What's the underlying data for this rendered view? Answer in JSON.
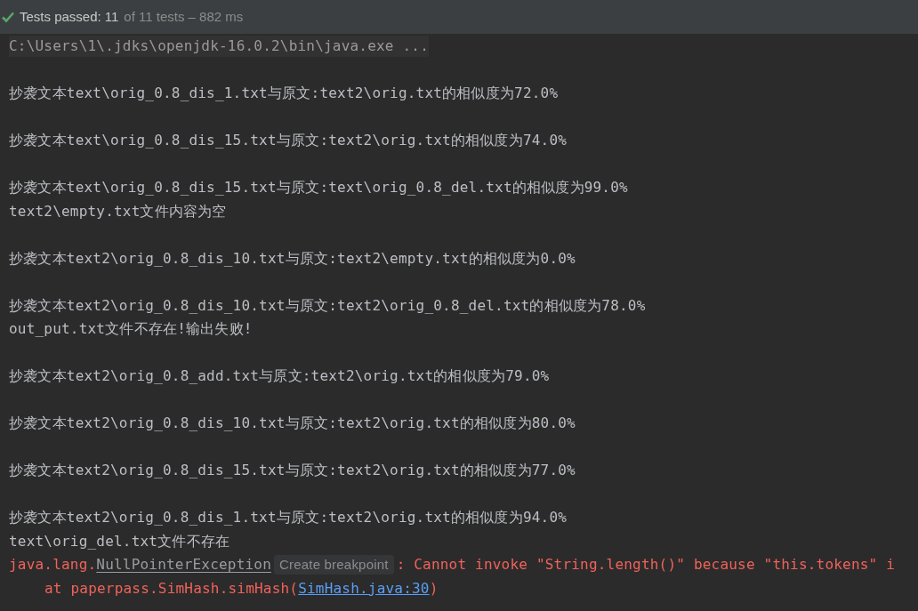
{
  "status": {
    "passed": true,
    "label": "Tests passed:",
    "count": "11",
    "detail": "of 11 tests – 882 ms"
  },
  "lines": [
    {
      "kind": "command",
      "gap_before": false,
      "text": "C:\\Users\\1\\.jdks\\openjdk-16.0.2\\bin\\java.exe ..."
    },
    {
      "kind": "output",
      "gap_before": true,
      "text": "抄袭文本text\\orig_0.8_dis_1.txt与原文:text2\\orig.txt的相似度为72.0%"
    },
    {
      "kind": "output",
      "gap_before": true,
      "text": "抄袭文本text\\orig_0.8_dis_15.txt与原文:text2\\orig.txt的相似度为74.0%"
    },
    {
      "kind": "output",
      "gap_before": true,
      "text": "抄袭文本text\\orig_0.8_dis_15.txt与原文:text\\orig_0.8_del.txt的相似度为99.0%"
    },
    {
      "kind": "output",
      "gap_before": false,
      "text": "text2\\empty.txt文件内容为空"
    },
    {
      "kind": "output",
      "gap_before": true,
      "text": "抄袭文本text2\\orig_0.8_dis_10.txt与原文:text2\\empty.txt的相似度为0.0%"
    },
    {
      "kind": "output",
      "gap_before": true,
      "text": "抄袭文本text2\\orig_0.8_dis_10.txt与原文:text2\\orig_0.8_del.txt的相似度为78.0%"
    },
    {
      "kind": "output",
      "gap_before": false,
      "text": "out_put.txt文件不存在!输出失败!"
    },
    {
      "kind": "output",
      "gap_before": true,
      "text": "抄袭文本text2\\orig_0.8_add.txt与原文:text2\\orig.txt的相似度为79.0%"
    },
    {
      "kind": "output",
      "gap_before": true,
      "text": "抄袭文本text2\\orig_0.8_dis_10.txt与原文:text2\\orig.txt的相似度为80.0%"
    },
    {
      "kind": "output",
      "gap_before": true,
      "text": "抄袭文本text2\\orig_0.8_dis_15.txt与原文:text2\\orig.txt的相似度为77.0%"
    },
    {
      "kind": "output",
      "gap_before": true,
      "text": "抄袭文本text2\\orig_0.8_dis_1.txt与原文:text2\\orig.txt的相似度为94.0%"
    },
    {
      "kind": "output",
      "gap_before": false,
      "text": "text\\orig_del.txt文件不存在"
    },
    {
      "kind": "exception",
      "gap_before": false,
      "prefix": "java.lang.",
      "link": "NullPointerException",
      "hint": "Create breakpoint",
      "text": ": Cannot invoke \"String.length()\" because \"this.tokens\" i"
    },
    {
      "kind": "trace",
      "gap_before": false,
      "prefix": "at paperpass.SimHash.simHash(",
      "link": "SimHash.java:30",
      "text": ")"
    }
  ]
}
